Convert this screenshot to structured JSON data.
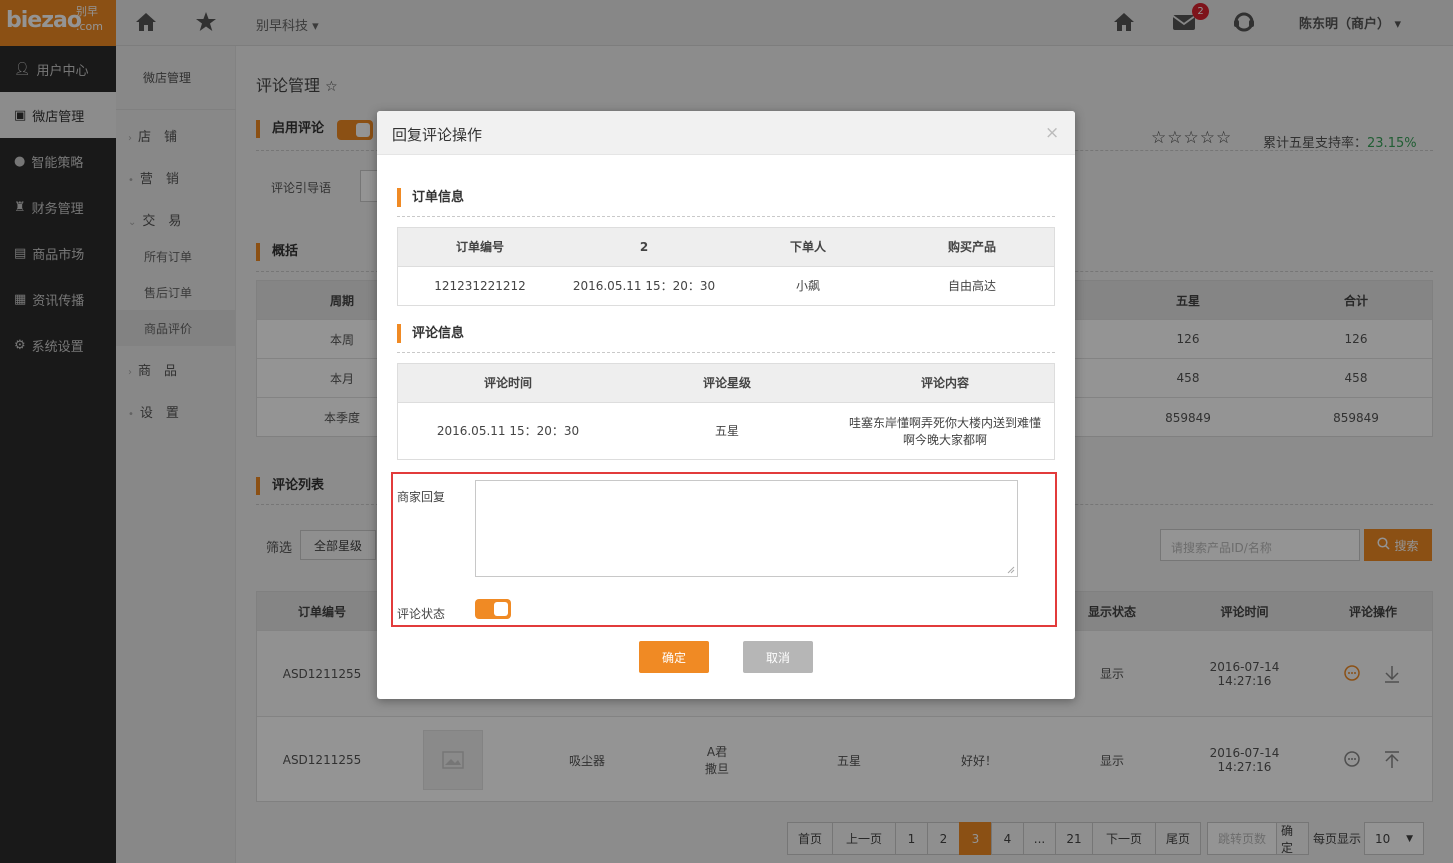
{
  "topbar": {
    "logo_brand": "biezao",
    "logo_cn": "别早",
    "logo_com": ".com",
    "company": "别早科技",
    "mail_count": "2",
    "user": "陈东明（商户）"
  },
  "sidebar": {
    "items": [
      {
        "label": "用户中心"
      },
      {
        "label": "微店管理"
      },
      {
        "label": "智能策略"
      },
      {
        "label": "财务管理"
      },
      {
        "label": "商品市场"
      },
      {
        "label": "资讯传播"
      },
      {
        "label": "系统设置"
      }
    ]
  },
  "subnav": {
    "header": "微店管理",
    "groups": [
      "店　铺",
      "营　销",
      "交　易",
      "商　品",
      "设　置"
    ],
    "leaves": [
      "所有订单",
      "售后订单",
      "商品评价"
    ]
  },
  "main": {
    "title": "评论管理",
    "enable_label": "启用评论",
    "guide_label": "评论引导语",
    "stars": "☆☆☆☆☆",
    "rate_label": "累计五星支持率：",
    "rate_value": "23.15%",
    "summary_title": "概括",
    "summary": {
      "headers": [
        "周期",
        "五星",
        "合计"
      ],
      "rows": [
        [
          "本周",
          "126",
          "126"
        ],
        [
          "本月",
          "458",
          "458"
        ],
        [
          "本季度",
          "859849",
          "859849"
        ]
      ]
    },
    "list_title": "评论列表",
    "filter_label": "筛选",
    "filter_all_stars": "全部星级",
    "search_placeholder": "请搜索产品ID/名称",
    "search_button": "搜索",
    "list": {
      "headers": [
        "订单编号",
        "显示状态",
        "评论时间",
        "评论操作"
      ],
      "rows": [
        {
          "order": "ASD1211255",
          "product": "",
          "user": "",
          "stars": "",
          "content": "",
          "status": "显示",
          "time": "2016-07-14\n14:27:16"
        },
        {
          "order": "ASD1211255",
          "product": "吸尘器",
          "user": "A君\n撒旦",
          "stars": "五星",
          "content": "好好！",
          "status": "显示",
          "time": "2016-07-14\n14:27:16"
        }
      ]
    },
    "pager": {
      "items": [
        "首页",
        "上一页",
        "1",
        "2",
        "3",
        "4",
        "...",
        "21",
        "下一页",
        "尾页"
      ],
      "active": "3",
      "jump_placeholder": "跳转页数",
      "confirm": "确定",
      "per_page_label": "每页显示",
      "per_page": "10"
    }
  },
  "modal": {
    "title": "回复评论操作",
    "close": "×",
    "order_section": "订单信息",
    "order_headers": [
      "订单编号",
      "2",
      "下单人",
      "购买产品"
    ],
    "order_row": [
      "121231221212",
      "2016.05.11 15：20：30",
      "小飙",
      "自由高达"
    ],
    "comment_section": "评论信息",
    "comment_headers": [
      "评论时间",
      "评论星级",
      "评论内容"
    ],
    "comment_row": [
      "2016.05.11 15：20：30",
      "五星",
      "哇塞东岸懂啊弄死你大楼内送到难懂啊今晚大家都啊"
    ],
    "reply_label": "商家回复",
    "status_label": "评论状态",
    "ok": "确定",
    "cancel": "取消"
  },
  "colors": {
    "accent": "#f08a24",
    "highlight": "#e23b3b",
    "rate": "#3aa35b"
  }
}
